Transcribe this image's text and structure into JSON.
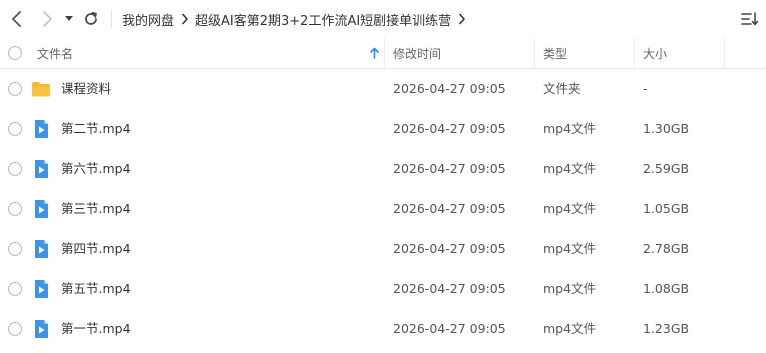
{
  "breadcrumb": {
    "root": "我的网盘",
    "current": "超级AI客第2期3+2工作流AI短剧接单训练营"
  },
  "columns": {
    "name": "文件名",
    "modified": "修改时间",
    "type": "类型",
    "size": "大小"
  },
  "files": [
    {
      "name": "课程资料",
      "modified": "2026-04-27 09:05",
      "type": "文件夹",
      "size": "-",
      "icon": "folder-icon"
    },
    {
      "name": "第二节.mp4",
      "modified": "2026-04-27 09:05",
      "type": "mp4文件",
      "size": "1.30GB",
      "icon": "video-file-icon"
    },
    {
      "name": "第六节.mp4",
      "modified": "2026-04-27 09:05",
      "type": "mp4文件",
      "size": "2.59GB",
      "icon": "video-file-icon"
    },
    {
      "name": "第三节.mp4",
      "modified": "2026-04-27 09:05",
      "type": "mp4文件",
      "size": "1.05GB",
      "icon": "video-file-icon"
    },
    {
      "name": "第四节.mp4",
      "modified": "2026-04-27 09:05",
      "type": "mp4文件",
      "size": "2.78GB",
      "icon": "video-file-icon"
    },
    {
      "name": "第五节.mp4",
      "modified": "2026-04-27 09:05",
      "type": "mp4文件",
      "size": "1.08GB",
      "icon": "video-file-icon"
    },
    {
      "name": "第一节.mp4",
      "modified": "2026-04-27 09:05",
      "type": "mp4文件",
      "size": "1.23GB",
      "icon": "video-file-icon"
    }
  ],
  "colors": {
    "folder": "#f7c443",
    "video": "#3d95e8",
    "sort_arrow": "#2a8cf0"
  }
}
